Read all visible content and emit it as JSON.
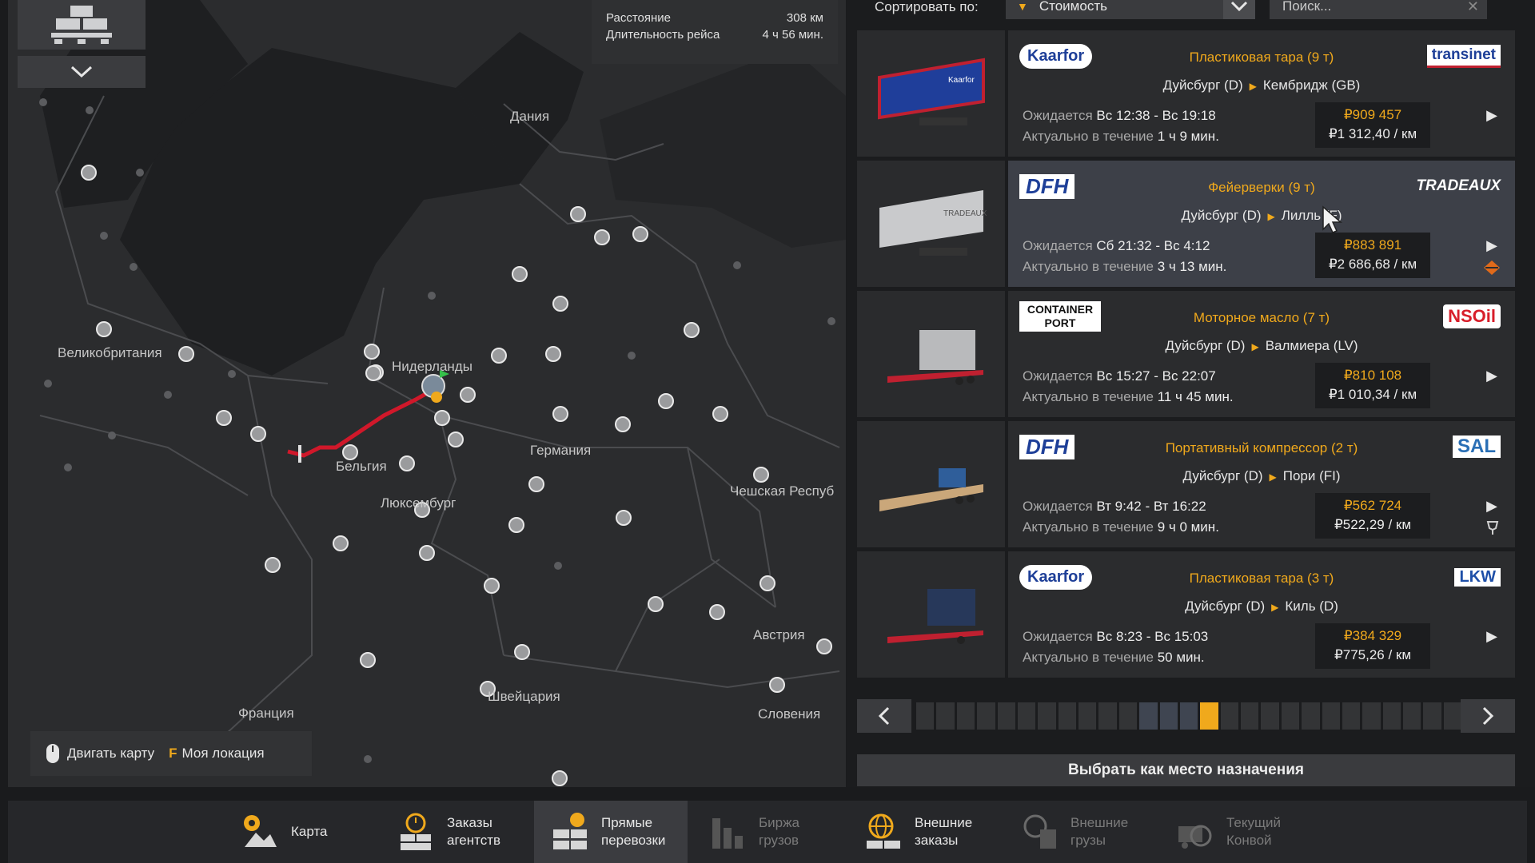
{
  "map": {
    "route_distance_label": "Расстояние",
    "route_distance_value": "308 км",
    "route_duration_label": "Длительность рейса",
    "route_duration_value": "4 ч 56 мин.",
    "countries": {
      "denmark": "Дания",
      "uk": "Великобритания",
      "netherlands": "Нидерланды",
      "belgium": "Бельгия",
      "luxembourg": "Люксембург",
      "germany": "Германия",
      "czech": "Чешская Респуб",
      "france": "Франция",
      "austria": "Австрия",
      "switzerland": "Швейцария",
      "slovenia": "Словения"
    },
    "hints": {
      "move_map": "Двигать карту",
      "my_location_key": "F",
      "my_location": "Моя локация"
    }
  },
  "sort": {
    "label": "Сортировать по:",
    "selected": "Стоимость",
    "search_placeholder": "Поиск..."
  },
  "jobs": [
    {
      "company": "Kaarfor",
      "recipient": "transinet",
      "cargo": "Пластиковая тара (9 т)",
      "from": "Дуйсбург (D)",
      "to": "Кембридж (GB)",
      "expect_label": "Ожидается",
      "expect": "Вс 12:38 - Вс 19:18",
      "valid_label": "Актуально в течение",
      "valid": "1 ч 9 мин.",
      "price": "₽909 457",
      "per_km": "₽1 312,40 / км"
    },
    {
      "company": "DFH",
      "recipient": "TRADEAUX",
      "cargo": "Фейерверки (9 т)",
      "from": "Дуйсбург (D)",
      "to": "Лилль (F)",
      "expect_label": "Ожидается",
      "expect": "Сб 21:32 - Вс 4:12",
      "valid_label": "Актуально в течение",
      "valid": "3 ч 13 мин.",
      "price": "₽883 891",
      "per_km": "₽2 686,68 / км"
    },
    {
      "company": "CONTAINER PORT",
      "recipient": "NSOil",
      "cargo": "Моторное масло (7 т)",
      "from": "Дуйсбург (D)",
      "to": "Валмиера (LV)",
      "expect_label": "Ожидается",
      "expect": "Вс 15:27 - Вс 22:07",
      "valid_label": "Актуально в течение",
      "valid": "11 ч 45 мин.",
      "price": "₽810 108",
      "per_km": "₽1 010,34 / км"
    },
    {
      "company": "DFH",
      "recipient": "SAL",
      "cargo": "Портативный компрессор (2 т)",
      "from": "Дуйсбург (D)",
      "to": "Пори (FI)",
      "expect_label": "Ожидается",
      "expect": "Вт 9:42 - Вт 16:22",
      "valid_label": "Актуально в течение",
      "valid": "9 ч 0 мин.",
      "price": "₽562 724",
      "per_km": "₽522,29 / км"
    },
    {
      "company": "Kaarfor",
      "recipient": "LKW",
      "cargo": "Пластиковая тара (3 т)",
      "from": "Дуйсбург (D)",
      "to": "Киль (D)",
      "expect_label": "Ожидается",
      "expect": "Вс 8:23 - Вс 15:03",
      "valid_label": "Актуально в течение",
      "valid": "50 мин.",
      "price": "₽384 329",
      "per_km": "₽775,26 / км"
    }
  ],
  "select_destination": "Выбрать как место назначения",
  "tabs": [
    {
      "l1": "Карта",
      "l2": ""
    },
    {
      "l1": "Заказы",
      "l2": "агентств"
    },
    {
      "l1": "Прямые",
      "l2": "перевозки"
    },
    {
      "l1": "Биржа",
      "l2": "грузов"
    },
    {
      "l1": "Внешние",
      "l2": "заказы"
    },
    {
      "l1": "Внешние",
      "l2": "грузы"
    },
    {
      "l1": "Текущий",
      "l2": "Конвой"
    }
  ],
  "colors": {
    "accent": "#f0a91c",
    "route": "#d0182a"
  }
}
